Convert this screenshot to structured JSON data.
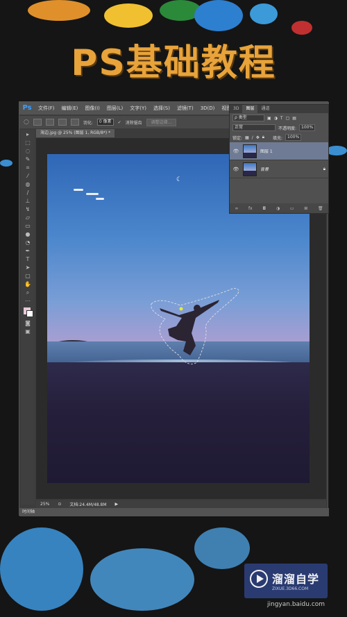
{
  "poster": {
    "title": "PS基础教程"
  },
  "photoshop": {
    "logo": "Ps",
    "menu": [
      "文件(F)",
      "编辑(E)",
      "图像(I)",
      "图层(L)",
      "文字(Y)",
      "选择(S)",
      "滤镜(T)",
      "3D(D)",
      "视图(V)"
    ],
    "options": {
      "feather_label": "羽化:",
      "feather_value": "0 像素",
      "antialias_label": "消除锯齿",
      "refine_edge": "调整边缘..."
    },
    "document_tab": "海边.jpg @ 25% (图层 1, RGB/8*) *",
    "status": {
      "zoom": "25%",
      "doc_size": "文档:24.4M/48.8M"
    },
    "timeline_label": "时间轴"
  },
  "layers_panel": {
    "tabs": [
      "3D",
      "图层",
      "通道"
    ],
    "filter_kind": "ρ 类型",
    "blend_mode": "正常",
    "opacity_label": "不透明度:",
    "opacity_value": "100%",
    "lock_label": "锁定:",
    "fill_label": "填充:",
    "fill_value": "100%",
    "layers": [
      {
        "name": "图层 1",
        "selected": true
      },
      {
        "name": "背景",
        "selected": false
      }
    ]
  },
  "watermark": {
    "brand": "溜溜自学",
    "url": "ZIXUE.3D66.COM",
    "source": "jingyan.baidu.com"
  },
  "colors": {
    "title": "#e8a33a",
    "ps_blue": "#3aa1ff",
    "panel_bg": "#505050"
  }
}
